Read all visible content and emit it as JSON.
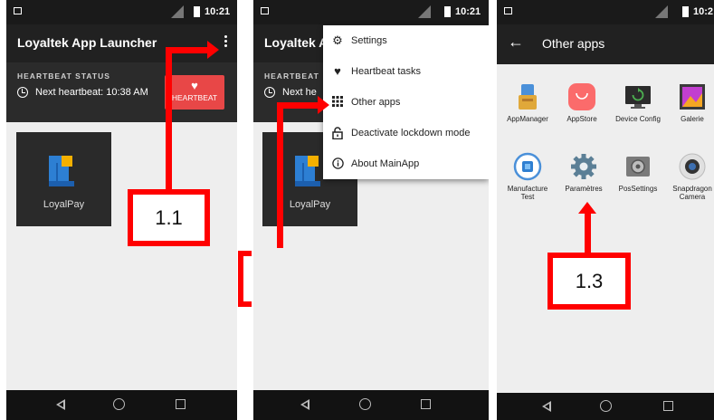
{
  "status_bar": {
    "time": "10:21"
  },
  "screen1": {
    "title": "Loyaltek App Launcher",
    "heartbeat_label": "HEARTBEAT STATUS",
    "next_heartbeat": "Next heartbeat: 10:38 AM",
    "heartbeat_button": "HEARTBEAT",
    "tile_label": "LoyalPay"
  },
  "screen2": {
    "title": "Loyaltek A",
    "heartbeat_label": "HEARTBEAT",
    "next_heartbeat": "Next he",
    "tile_label": "LoyalPay",
    "menu": [
      {
        "label": "Settings",
        "icon": "gear-icon"
      },
      {
        "label": "Heartbeat tasks",
        "icon": "heart-icon"
      },
      {
        "label": "Other apps",
        "icon": "grid-icon"
      },
      {
        "label": "Deactivate lockdown mode",
        "icon": "unlock-icon"
      },
      {
        "label": "About MainApp",
        "icon": "info-icon"
      }
    ]
  },
  "screen3": {
    "title": "Other apps",
    "time": "10:2",
    "apps": [
      {
        "label": "AppManager",
        "icon": "appmanager-icon"
      },
      {
        "label": "AppStore",
        "icon": "appstore-icon"
      },
      {
        "label": "Device Config",
        "icon": "device-config-icon"
      },
      {
        "label": "Galerie",
        "icon": "gallery-icon"
      },
      {
        "label": "Manufacture Test",
        "icon": "manufacture-test-icon"
      },
      {
        "label": "Paramètres",
        "icon": "settings-gear-icon"
      },
      {
        "label": "PosSettings",
        "icon": "pos-settings-icon"
      },
      {
        "label": "Snapdragon Camera",
        "icon": "camera-icon"
      }
    ]
  },
  "annotations": {
    "step1": "1.1",
    "step3": "1.3",
    "color": "#ff0000"
  }
}
